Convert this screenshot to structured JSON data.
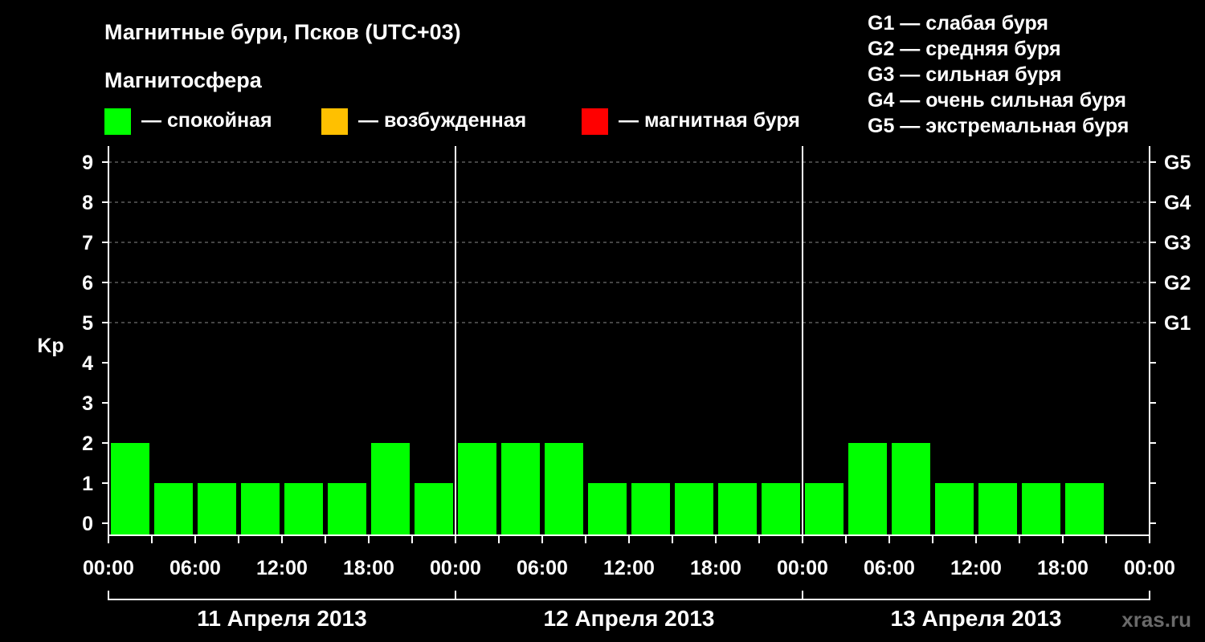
{
  "title": "Магнитные бури, Псков (UTC+03)",
  "legend": {
    "heading": "Магнитосфера",
    "items": [
      {
        "color": "#00ff00",
        "label": "— спокойная"
      },
      {
        "color": "#ffc000",
        "label": "— возбужденная"
      },
      {
        "color": "#ff0000",
        "label": "— магнитная буря"
      }
    ]
  },
  "storm_levels": [
    "G1 — слабая буря",
    "G2 — средняя буря",
    "G3 — сильная буря",
    "G4 — очень сильная буря",
    "G5 — экстремальная буря"
  ],
  "watermark": "xras.ru",
  "chart_data": {
    "type": "bar",
    "ylabel": "Kp",
    "ylim": [
      0,
      9
    ],
    "y_ticks": [
      "0",
      "1",
      "2",
      "3",
      "4",
      "5",
      "6",
      "7",
      "8",
      "9"
    ],
    "right_ticks": [
      {
        "kp": 5,
        "label": "G1"
      },
      {
        "kp": 6,
        "label": "G2"
      },
      {
        "kp": 7,
        "label": "G3"
      },
      {
        "kp": 8,
        "label": "G4"
      },
      {
        "kp": 9,
        "label": "G5"
      }
    ],
    "grid": "dashed horizontal at Kp 5-9",
    "hours_per_bar": 3,
    "x_tick_labels": [
      "00:00",
      "06:00",
      "12:00",
      "18:00"
    ],
    "final_tick_label": "00:00",
    "days": [
      "11 Апреля 2013",
      "12 Апреля 2013",
      "13 Апреля 2013"
    ],
    "bar_color": "#00ff00",
    "values": [
      [
        2,
        1,
        1,
        1,
        1,
        1,
        2,
        1
      ],
      [
        2,
        2,
        2,
        1,
        1,
        1,
        1,
        1
      ],
      [
        1,
        2,
        2,
        1,
        1,
        1,
        1
      ]
    ]
  }
}
